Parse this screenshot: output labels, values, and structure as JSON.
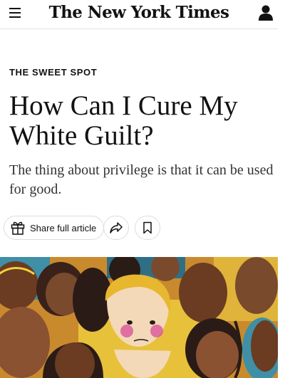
{
  "header": {
    "masthead": "The New York Times",
    "menu_icon": "hamburger-menu-icon",
    "account_icon": "user-account-icon"
  },
  "article": {
    "kicker": "THE SWEET SPOT",
    "headline": "How Can I Cure My White Guilt?",
    "summary": "The thing about privilege is that it can be used for good."
  },
  "actions": {
    "share_label": "Share full article",
    "gift_icon": "gift-icon",
    "share_icon": "share-arrow-icon",
    "bookmark_icon": "bookmark-icon"
  },
  "image": {
    "name": "article-illustration",
    "colors": {
      "yellow": "#e8b730",
      "orange": "#d9822b",
      "teal": "#3f8fa6",
      "dark": "#2a1b17"
    }
  }
}
